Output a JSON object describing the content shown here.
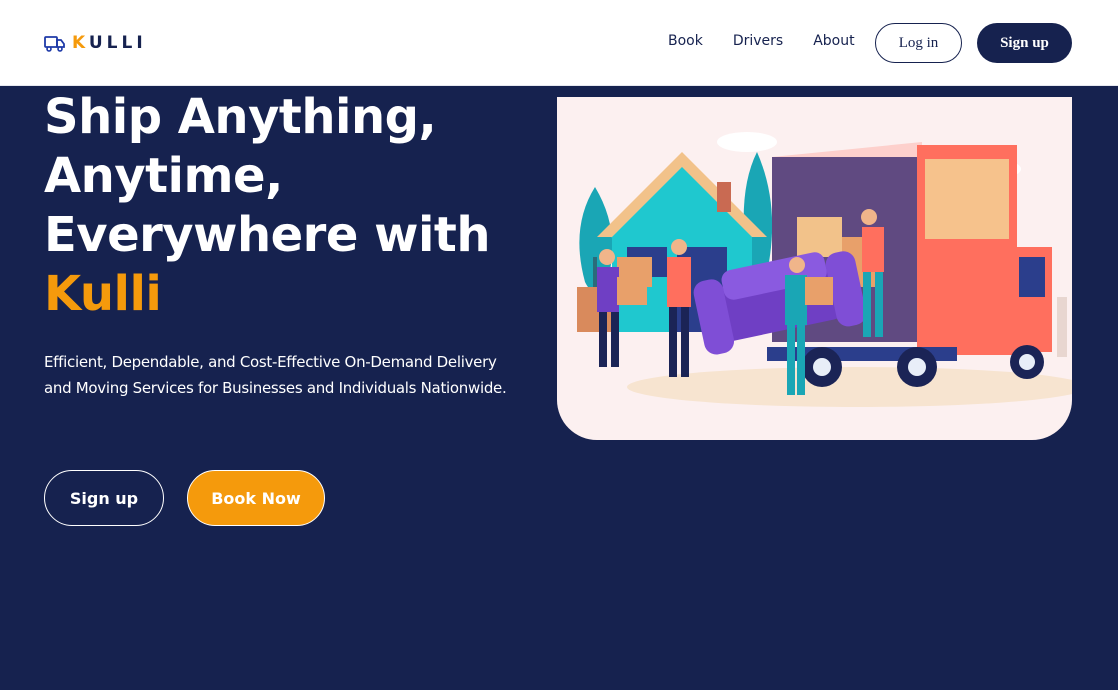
{
  "brand": {
    "name_accent": "K",
    "name_rest": "ULLI",
    "icon": "truck-icon"
  },
  "nav": {
    "links": [
      "Book",
      "Drivers",
      "About"
    ],
    "login": "Log in",
    "signup": "Sign up"
  },
  "hero": {
    "title_lines": [
      "Ship Anything,",
      "Anytime,",
      "Everywhere with"
    ],
    "title_accent": "Kulli",
    "subtitle": "Efficient, Dependable, and Cost-Effective On-Demand Delivery and Moving Services for Businesses and Individuals Nationwide.",
    "primary_button": "Sign up",
    "secondary_button": "Book Now",
    "illustration": "movers-loading-truck-illustration"
  },
  "colors": {
    "navy": "#16224f",
    "orange": "#f59a0c",
    "white": "#ffffff",
    "illustration_bg": "#fcf0f0"
  }
}
